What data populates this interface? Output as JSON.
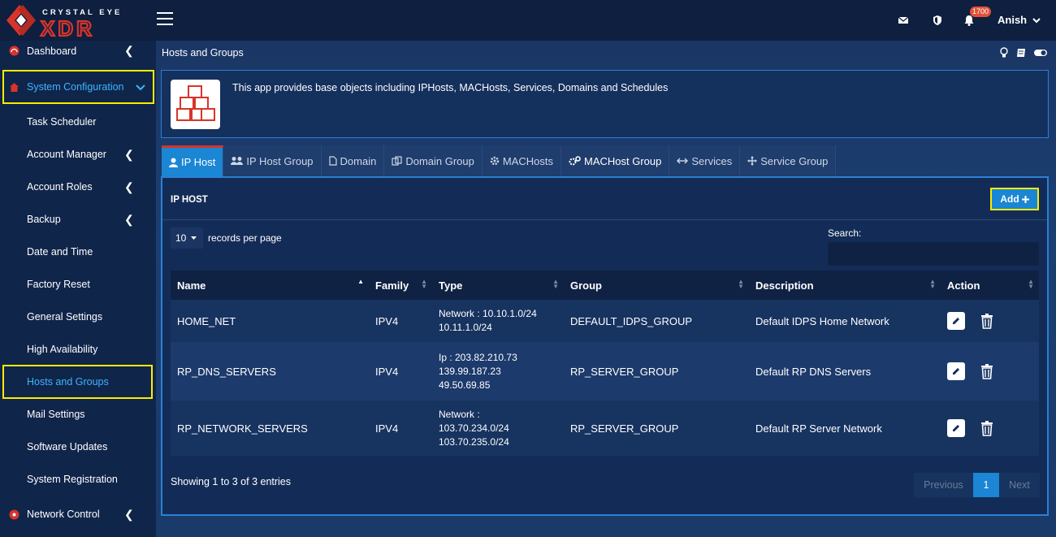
{
  "app": {
    "logo_top": "CRYSTAL EYE",
    "logo_bottom": "XDR",
    "notif_count": "1700",
    "user_name": "Anish"
  },
  "sidebar": {
    "items": [
      {
        "label": "Dashboard"
      },
      {
        "label": "System Configuration"
      },
      {
        "label": "Task Scheduler"
      },
      {
        "label": "Account Manager"
      },
      {
        "label": "Account Roles"
      },
      {
        "label": "Backup"
      },
      {
        "label": "Date and Time"
      },
      {
        "label": "Factory Reset"
      },
      {
        "label": "General Settings"
      },
      {
        "label": "High Availability"
      },
      {
        "label": "Hosts and Groups"
      },
      {
        "label": "Mail Settings"
      },
      {
        "label": "Software Updates"
      },
      {
        "label": "System Registration"
      },
      {
        "label": "Network Control"
      }
    ]
  },
  "page": {
    "title": "Hosts and Groups",
    "info_text": "This app provides base objects including IPHosts, MACHosts, Services, Domains and Schedules"
  },
  "tabs": [
    {
      "label": "IP Host"
    },
    {
      "label": "IP Host Group"
    },
    {
      "label": "Domain"
    },
    {
      "label": "Domain Group"
    },
    {
      "label": "MACHosts"
    },
    {
      "label": "MACHost Group"
    },
    {
      "label": "Services"
    },
    {
      "label": "Service Group"
    }
  ],
  "panel": {
    "title": "IP HOST",
    "add_label": "Add",
    "page_size": "10",
    "records_label": "records per page",
    "search_label": "Search:",
    "columns": [
      "Name",
      "Family",
      "Type",
      "Group",
      "Description",
      "Action"
    ],
    "rows": [
      {
        "name": "HOME_NET",
        "family": "IPV4",
        "type": [
          "Network : 10.10.1.0/24",
          "10.11.1.0/24"
        ],
        "group": "DEFAULT_IDPS_GROUP",
        "description": "Default IDPS Home Network"
      },
      {
        "name": "RP_DNS_SERVERS",
        "family": "IPV4",
        "type": [
          "Ip : 203.82.210.73",
          "139.99.187.23",
          "49.50.69.85"
        ],
        "group": "RP_SERVER_GROUP",
        "description": "Default RP DNS Servers"
      },
      {
        "name": "RP_NETWORK_SERVERS",
        "family": "IPV4",
        "type": [
          "Network :",
          "103.70.234.0/24",
          "103.70.235.0/24"
        ],
        "group": "RP_SERVER_GROUP",
        "description": "Default RP Server Network"
      }
    ],
    "footer_info": "Showing 1 to 3 of 3 entries",
    "pager": {
      "previous": "Previous",
      "current": "1",
      "next": "Next"
    }
  }
}
